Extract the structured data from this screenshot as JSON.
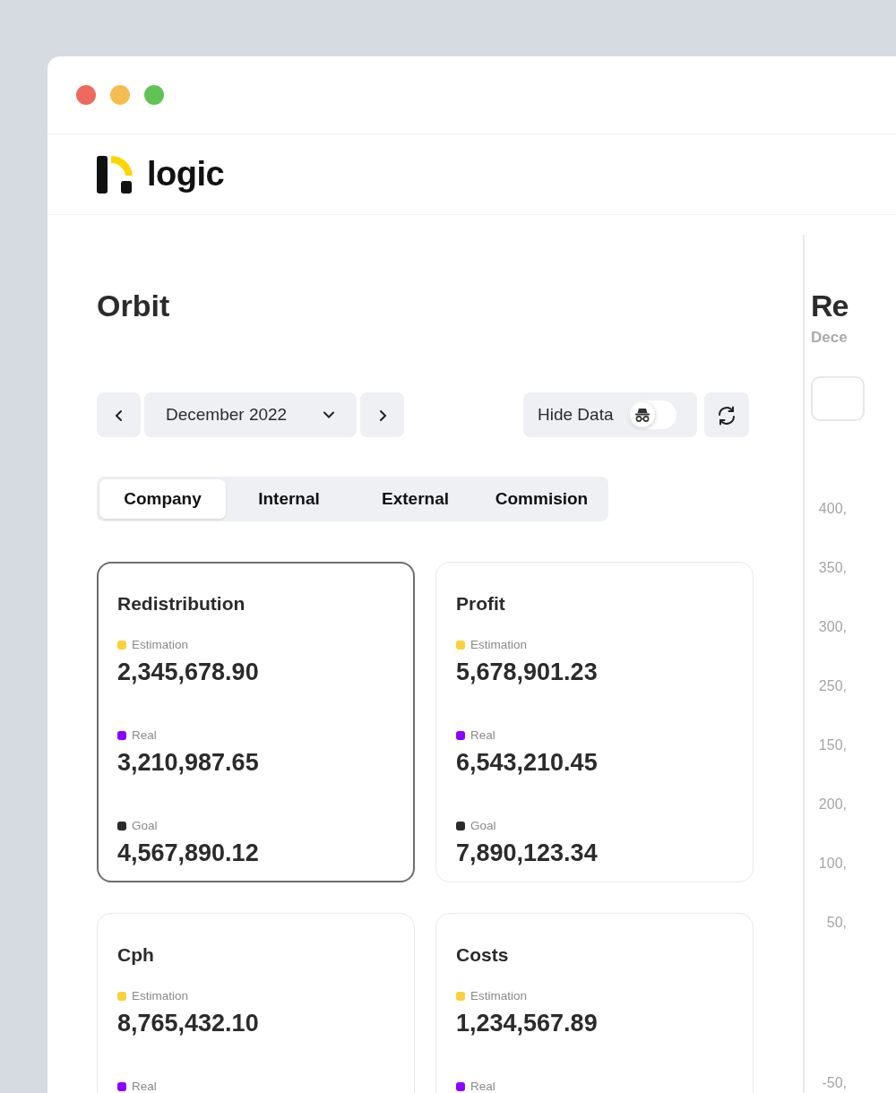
{
  "brand": {
    "name": "logic"
  },
  "page": {
    "title": "Orbit"
  },
  "period": {
    "label": "December 2022"
  },
  "hide_data": {
    "label": "Hide Data",
    "on": false
  },
  "tabs": [
    {
      "label": "Company",
      "selected": true
    },
    {
      "label": "Internal",
      "selected": false
    },
    {
      "label": "External",
      "selected": false
    },
    {
      "label": "Commision",
      "selected": false
    }
  ],
  "cards": [
    {
      "title": "Redistribution",
      "selected": true,
      "metrics": [
        {
          "label": "Estimation",
          "color": "#fbd13c",
          "value": "2,345,678.90"
        },
        {
          "label": "Real",
          "color": "#8b00ff",
          "value": "3,210,987.65"
        },
        {
          "label": "Goal",
          "color": "#2b2b2b",
          "value": "4,567,890.12"
        }
      ]
    },
    {
      "title": "Profit",
      "selected": false,
      "metrics": [
        {
          "label": "Estimation",
          "color": "#fbd13c",
          "value": "5,678,901.23"
        },
        {
          "label": "Real",
          "color": "#8b00ff",
          "value": "6,543,210.45"
        },
        {
          "label": "Goal",
          "color": "#2b2b2b",
          "value": "7,890,123.34"
        }
      ]
    },
    {
      "title": "Cph",
      "selected": false,
      "metrics": [
        {
          "label": "Estimation",
          "color": "#fbd13c",
          "value": "8,765,432.10"
        },
        {
          "label": "Real",
          "color": "#8b00ff"
        }
      ]
    },
    {
      "title": "Costs",
      "selected": false,
      "metrics": [
        {
          "label": "Estimation",
          "color": "#fbd13c",
          "value": "1,234,567.89"
        },
        {
          "label": "Real",
          "color": "#8b00ff"
        }
      ]
    }
  ],
  "side_panel": {
    "title": "Re",
    "subtitle": "Dece",
    "axis_labels": [
      "400,",
      "350,",
      "300,",
      "250,",
      "150,",
      "200,",
      "100,",
      "50,",
      "-50,"
    ]
  }
}
